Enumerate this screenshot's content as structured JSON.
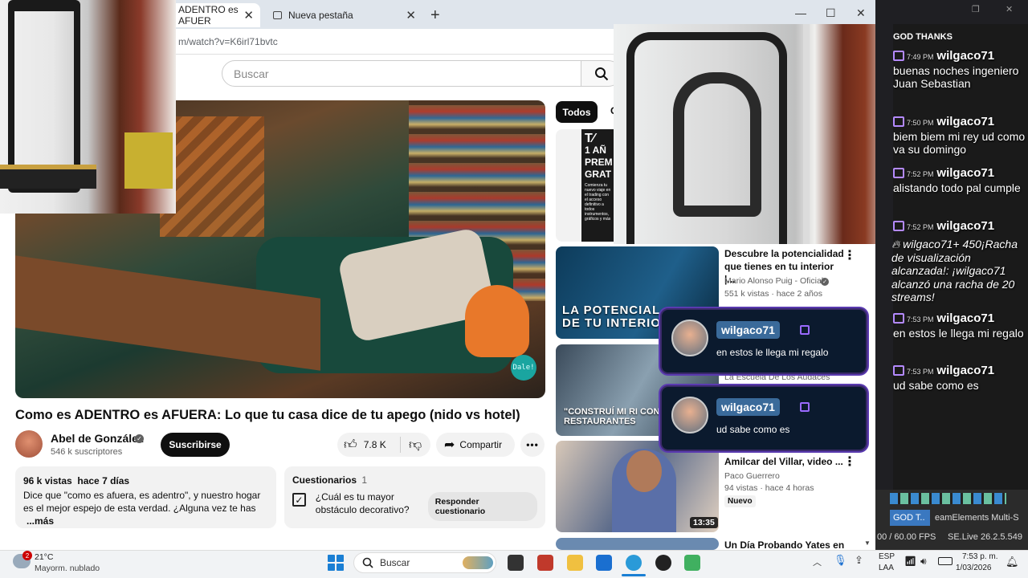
{
  "browser": {
    "tabs": [
      {
        "label": "ADENTRO es AFUER"
      },
      {
        "label": "Nueva pestaña"
      }
    ],
    "url": "m/watch?v=K6irl71bvtc"
  },
  "youtube": {
    "search_placeholder": "Buscar",
    "video": {
      "overlay_badge": "Dale!",
      "title": "Como es ADENTRO es AFUERA: Lo que tu casa dice de tu apego (nido vs hotel)",
      "channel": "Abel de González",
      "subscribers": "546 k suscriptores",
      "subscribe_label": "Suscribirse",
      "likes": "7.8 K",
      "share_label": "Compartir"
    },
    "description": {
      "stats": "96 k vistas  hace 7 días",
      "text": "Dice que \"como es afuera, es adentro\", y nuestro hogar es el mejor espejo de esta verdad. ¿Alguna vez te has",
      "more": "...más"
    },
    "quiz": {
      "header": "Cuestionarios",
      "count": "1",
      "question": "¿Cuál es tu mayor obstáculo decorativo?",
      "button": "Responder cuestionario"
    },
    "chips": {
      "all": "Todos",
      "next": "C"
    },
    "ad": {
      "text": "1 AÑ PREM GRAT",
      "sub": "Comienza tu nuevo viaje en el trading con el acceso definitivo a todos instrumentos, gráficos y más"
    },
    "recommendations": [
      {
        "thumb_text": "LA POTENCIAL DE TU INTERIO",
        "title": "Descubre la potencialidad que tienes en tu interior |...",
        "channel": "Mario Alonso Puig - Oficial",
        "meta": "551 k vistas · hace 2 años"
      },
      {
        "thumb_text": "\"CONSTRUÍ MI RI CON RESTAURANTES",
        "channel": "La Escuela De Los Audaces"
      },
      {
        "title": "Amilcar del Villar, video ...",
        "channel": "Paco Guerrero",
        "meta": "94 vistas · hace 4 horas",
        "badge": "Nuevo",
        "duration": "13:35"
      },
      {
        "title": "Un Día Probando Yates en"
      }
    ]
  },
  "chat": {
    "header": "GOD THANKS",
    "messages": [
      {
        "time": "7:49 PM",
        "user": "wilgaco71",
        "text": "buenas noches ingeniero Juan Sebastian"
      },
      {
        "time": "7:50 PM",
        "user": "wilgaco71",
        "text": "biem biem mi rey ud como va su domingo"
      },
      {
        "time": "7:52 PM",
        "user": "wilgaco71",
        "text": "alistando todo pal cumple"
      },
      {
        "time": "7:52 PM",
        "user": "wilgaco71",
        "text": ""
      },
      {
        "time": "7:53 PM",
        "user": "wilgaco71",
        "text": "en estos le llega mi regalo"
      },
      {
        "time": "7:53 PM",
        "user": "wilgaco71",
        "text": "ud sabe como es"
      }
    ],
    "streak": "wilgaco71+ 450¡Racha de visualización alcanzada!: ¡wilgaco71 alcanzó una racha de 20 streams!",
    "tab1": "GOD T..",
    "tab2": "eamElements Multi-S",
    "fps": "00 / 60.00 FPS",
    "version": "SE.Live 26.2.5.549"
  },
  "popups": [
    {
      "user": "wilgaco71",
      "message": "en estos le llega mi regalo"
    },
    {
      "user": "wilgaco71",
      "message": "ud sabe como es"
    }
  ],
  "taskbar": {
    "weather_badge": "2",
    "temp": "21°C",
    "condition": "Mayorm. nublado",
    "search": "Buscar",
    "lang1": "ESP",
    "lang2": "LAA",
    "time": "7:53 p. m.",
    "date": "1/03/2026"
  }
}
